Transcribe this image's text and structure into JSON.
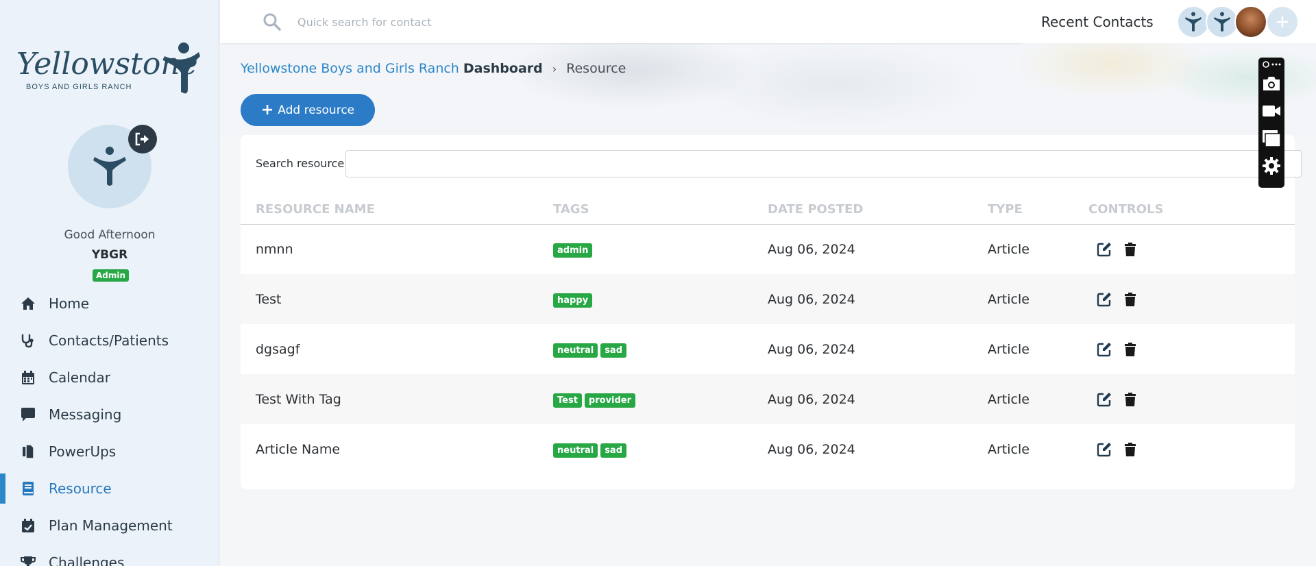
{
  "app": {
    "logo_text": "Yellowstone",
    "logo_subtext": "BOYS AND GIRLS RANCH"
  },
  "user": {
    "greeting": "Good Afternoon",
    "name": "YBGR",
    "role": "Admin"
  },
  "sidebar": {
    "items": [
      {
        "label": "Home",
        "icon": "home-icon"
      },
      {
        "label": "Contacts/Patients",
        "icon": "stethoscope-icon"
      },
      {
        "label": "Calendar",
        "icon": "calendar-icon"
      },
      {
        "label": "Messaging",
        "icon": "message-icon"
      },
      {
        "label": "PowerUps",
        "icon": "copy-icon"
      },
      {
        "label": "Resource",
        "icon": "book-icon",
        "active": true
      },
      {
        "label": "Plan Management",
        "icon": "calendar-check-icon"
      },
      {
        "label": "Challenges",
        "icon": "trophy-icon"
      }
    ]
  },
  "topbar": {
    "search_placeholder": "Quick search for contact",
    "recent_label": "Recent Contacts"
  },
  "breadcrumb": {
    "root": "Yellowstone Boys and Girls Ranch",
    "dashboard": "Dashboard",
    "current": "Resource"
  },
  "main": {
    "add_button_label": "Add resource",
    "search_label": "Search resource",
    "columns": [
      "RESOURCE NAME",
      "TAGS",
      "DATE POSTED",
      "TYPE",
      "CONTROLS"
    ],
    "rows": [
      {
        "name": "nmnn",
        "tags": [
          "admin"
        ],
        "date": "Aug 06, 2024",
        "type": "Article"
      },
      {
        "name": "Test",
        "tags": [
          "happy"
        ],
        "date": "Aug 06, 2024",
        "type": "Article"
      },
      {
        "name": "dgsagf",
        "tags": [
          "neutral",
          "sad"
        ],
        "date": "Aug 06, 2024",
        "type": "Article"
      },
      {
        "name": "Test With Tag",
        "tags": [
          "Test",
          "provider"
        ],
        "date": "Aug 06, 2024",
        "type": "Article"
      },
      {
        "name": "Article Name",
        "tags": [
          "neutral",
          "sad"
        ],
        "date": "Aug 06, 2024",
        "type": "Article"
      }
    ]
  },
  "colors": {
    "accent": "#2c7bc6",
    "tag": "#28a745",
    "nav_active": "#2779bd",
    "dark": "#2b3a46"
  }
}
